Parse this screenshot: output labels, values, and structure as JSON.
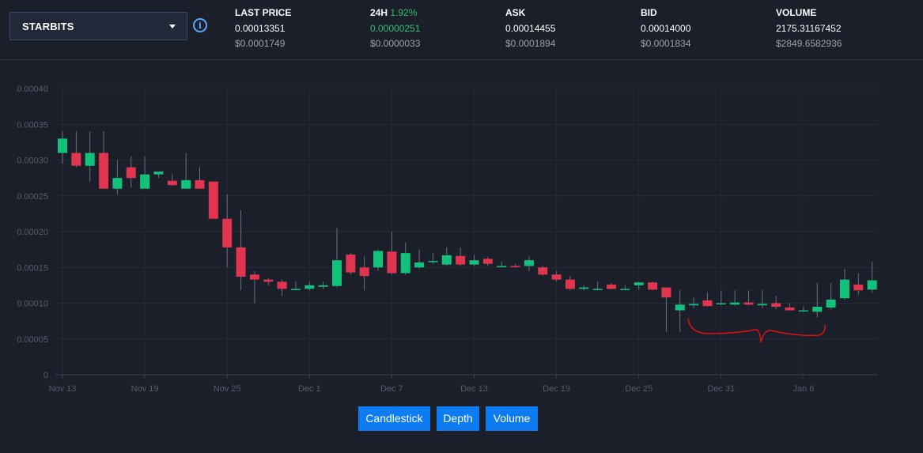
{
  "market": {
    "name": "STARBITS"
  },
  "stats": {
    "last_price": {
      "label": "LAST PRICE",
      "value": "0.00013351",
      "usd": "$0.0001749"
    },
    "change_24h": {
      "label": "24H",
      "pct": "1.92%",
      "value": "0.00000251",
      "usd": "$0.0000033"
    },
    "ask": {
      "label": "ASK",
      "value": "0.00014455",
      "usd": "$0.0001894"
    },
    "bid": {
      "label": "BID",
      "value": "0.00014000",
      "usd": "$0.0001834"
    },
    "volume": {
      "label": "VOLUME",
      "value": "2175.31167452",
      "usd": "$2849.6582936"
    }
  },
  "buttons": {
    "candlestick": "Candlestick",
    "depth": "Depth",
    "volume": "Volume"
  },
  "colors": {
    "up": "#12c27b",
    "down": "#e0344f",
    "accent": "#0d7cf2",
    "background": "#1b1f2a",
    "annotation": "#e01010"
  },
  "chart_data": {
    "type": "candlestick",
    "ylim": [
      0,
      0.0004
    ],
    "y_ticks": [
      "0",
      "0.00005",
      "0.00010",
      "0.00015",
      "0.00020",
      "0.00025",
      "0.00030",
      "0.00035",
      "0.00040"
    ],
    "x_ticks": [
      {
        "label": "Nov 13",
        "index": 0
      },
      {
        "label": "Nov 19",
        "index": 6
      },
      {
        "label": "Nov 25",
        "index": 12
      },
      {
        "label": "Dec 1",
        "index": 18
      },
      {
        "label": "Dec 7",
        "index": 24
      },
      {
        "label": "Dec 13",
        "index": 30
      },
      {
        "label": "Dec 19",
        "index": 36
      },
      {
        "label": "Dec 25",
        "index": 42
      },
      {
        "label": "Dec 31",
        "index": 48
      },
      {
        "label": "Jan 6",
        "index": 54
      }
    ],
    "grid": true,
    "candles": [
      {
        "o": 0.00031,
        "h": 0.00034,
        "l": 0.000295,
        "c": 0.00033
      },
      {
        "o": 0.00031,
        "h": 0.00034,
        "l": 0.00029,
        "c": 0.000292
      },
      {
        "o": 0.000292,
        "h": 0.00034,
        "l": 0.00027,
        "c": 0.00031
      },
      {
        "o": 0.00031,
        "h": 0.00034,
        "l": 0.00026,
        "c": 0.00026
      },
      {
        "o": 0.00026,
        "h": 0.0003,
        "l": 0.000252,
        "c": 0.000275
      },
      {
        "o": 0.00029,
        "h": 0.000305,
        "l": 0.000262,
        "c": 0.000275
      },
      {
        "o": 0.00026,
        "h": 0.000305,
        "l": 0.00026,
        "c": 0.00028
      },
      {
        "o": 0.00028,
        "h": 0.000284,
        "l": 0.000275,
        "c": 0.000284
      },
      {
        "o": 0.000271,
        "h": 0.00028,
        "l": 0.000264,
        "c": 0.000265
      },
      {
        "o": 0.00026,
        "h": 0.00031,
        "l": 0.00026,
        "c": 0.000272
      },
      {
        "o": 0.000272,
        "h": 0.00029,
        "l": 0.00026,
        "c": 0.00026
      },
      {
        "o": 0.00027,
        "h": 0.00027,
        "l": 0.000218,
        "c": 0.000218
      },
      {
        "o": 0.000218,
        "h": 0.000252,
        "l": 0.00015,
        "c": 0.000178
      },
      {
        "o": 0.000178,
        "h": 0.00023,
        "l": 0.000118,
        "c": 0.000137
      },
      {
        "o": 0.00014,
        "h": 0.000145,
        "l": 0.0001,
        "c": 0.000133
      },
      {
        "o": 0.000133,
        "h": 0.000135,
        "l": 0.000125,
        "c": 0.00013
      },
      {
        "o": 0.00013,
        "h": 0.000133,
        "l": 0.00011,
        "c": 0.00012
      },
      {
        "o": 0.00012,
        "h": 0.00013,
        "l": 0.000118,
        "c": 0.00012
      },
      {
        "o": 0.00012,
        "h": 0.00013,
        "l": 0.000118,
        "c": 0.000125
      },
      {
        "o": 0.000123,
        "h": 0.00013,
        "l": 0.00012,
        "c": 0.000125
      },
      {
        "o": 0.000124,
        "h": 0.000205,
        "l": 0.000122,
        "c": 0.00016
      },
      {
        "o": 0.000168,
        "h": 0.00017,
        "l": 0.00014,
        "c": 0.000143
      },
      {
        "o": 0.00015,
        "h": 0.000165,
        "l": 0.000118,
        "c": 0.000138
      },
      {
        "o": 0.00015,
        "h": 0.000175,
        "l": 0.000145,
        "c": 0.000173
      },
      {
        "o": 0.000172,
        "h": 0.0002,
        "l": 0.00014,
        "c": 0.000142
      },
      {
        "o": 0.000142,
        "h": 0.000185,
        "l": 0.00014,
        "c": 0.00017
      },
      {
        "o": 0.00015,
        "h": 0.000175,
        "l": 0.000148,
        "c": 0.000157
      },
      {
        "o": 0.000158,
        "h": 0.00017,
        "l": 0.000155,
        "c": 0.000159
      },
      {
        "o": 0.000154,
        "h": 0.000178,
        "l": 0.000152,
        "c": 0.000167
      },
      {
        "o": 0.000166,
        "h": 0.000178,
        "l": 0.000152,
        "c": 0.000154
      },
      {
        "o": 0.000154,
        "h": 0.000168,
        "l": 0.000152,
        "c": 0.00016
      },
      {
        "o": 0.000162,
        "h": 0.000165,
        "l": 0.000152,
        "c": 0.000155
      },
      {
        "o": 0.000152,
        "h": 0.000158,
        "l": 0.00015,
        "c": 0.000152
      },
      {
        "o": 0.000152,
        "h": 0.000155,
        "l": 0.00015,
        "c": 0.000151
      },
      {
        "o": 0.000152,
        "h": 0.000165,
        "l": 0.000145,
        "c": 0.00016
      },
      {
        "o": 0.00015,
        "h": 0.000152,
        "l": 0.000138,
        "c": 0.00014
      },
      {
        "o": 0.00014,
        "h": 0.000145,
        "l": 0.00013,
        "c": 0.000133
      },
      {
        "o": 0.000133,
        "h": 0.000138,
        "l": 0.000118,
        "c": 0.00012
      },
      {
        "o": 0.00012,
        "h": 0.000125,
        "l": 0.000118,
        "c": 0.000122
      },
      {
        "o": 0.00012,
        "h": 0.00013,
        "l": 0.000119,
        "c": 0.00012
      },
      {
        "o": 0.000126,
        "h": 0.000128,
        "l": 0.000119,
        "c": 0.00012
      },
      {
        "o": 0.00012,
        "h": 0.000125,
        "l": 0.000119,
        "c": 0.00012
      },
      {
        "o": 0.000125,
        "h": 0.00013,
        "l": 0.000119,
        "c": 0.000129
      },
      {
        "o": 0.000129,
        "h": 0.00013,
        "l": 0.000118,
        "c": 0.000119
      },
      {
        "o": 0.000122,
        "h": 0.000122,
        "l": 6e-05,
        "c": 0.000108
      },
      {
        "o": 9e-05,
        "h": 0.000118,
        "l": 6e-05,
        "c": 9.8e-05
      },
      {
        "o": 9.7e-05,
        "h": 0.000108,
        "l": 9.3e-05,
        "c": 9.9e-05
      },
      {
        "o": 0.000104,
        "h": 0.000115,
        "l": 9.5e-05,
        "c": 9.6e-05
      },
      {
        "o": 9.9e-05,
        "h": 0.000118,
        "l": 9.7e-05,
        "c": 0.0001
      },
      {
        "o": 9.8e-05,
        "h": 0.000118,
        "l": 9.7e-05,
        "c": 0.000101
      },
      {
        "o": 0.000101,
        "h": 0.000118,
        "l": 9.7e-05,
        "c": 9.8e-05
      },
      {
        "o": 9.7e-05,
        "h": 0.000118,
        "l": 9.3e-05,
        "c": 9.9e-05
      },
      {
        "o": 0.0001,
        "h": 0.00011,
        "l": 9.2e-05,
        "c": 9.5e-05
      },
      {
        "o": 9.4e-05,
        "h": 0.0001,
        "l": 9e-05,
        "c": 9e-05
      },
      {
        "o": 9e-05,
        "h": 9.5e-05,
        "l": 8.8e-05,
        "c": 9e-05
      },
      {
        "o": 8.8e-05,
        "h": 0.000128,
        "l": 8e-05,
        "c": 9.5e-05
      },
      {
        "o": 9.4e-05,
        "h": 0.000128,
        "l": 9.2e-05,
        "c": 0.000105
      },
      {
        "o": 0.000107,
        "h": 0.000148,
        "l": 0.000105,
        "c": 0.000133
      },
      {
        "o": 0.000126,
        "h": 0.000142,
        "l": 0.000112,
        "c": 0.000118
      },
      {
        "o": 0.000119,
        "h": 0.000158,
        "l": 0.000115,
        "c": 0.000132
      }
    ]
  }
}
